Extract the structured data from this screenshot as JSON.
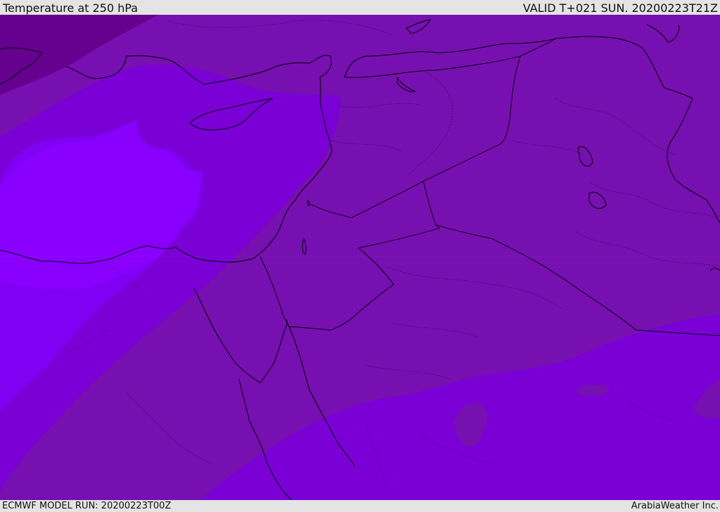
{
  "header": {
    "title": "Temperature at 250 hPa",
    "valid_time": "VALID T+021 SUN. 20200223T21Z"
  },
  "footer": {
    "model_run": "ECMWF MODEL RUN: 20200223T00Z",
    "credit": "ArabiaWeather Inc."
  },
  "map": {
    "region": "Eastern Mediterranean and Middle East",
    "colors": {
      "darkest_band": "#66008f",
      "dark_band": "#7710b0",
      "medium_band": "#7a00d6",
      "light_band": "#8000f3",
      "lightest_band": "#8a00ff",
      "boundary_line": "#000000"
    }
  }
}
